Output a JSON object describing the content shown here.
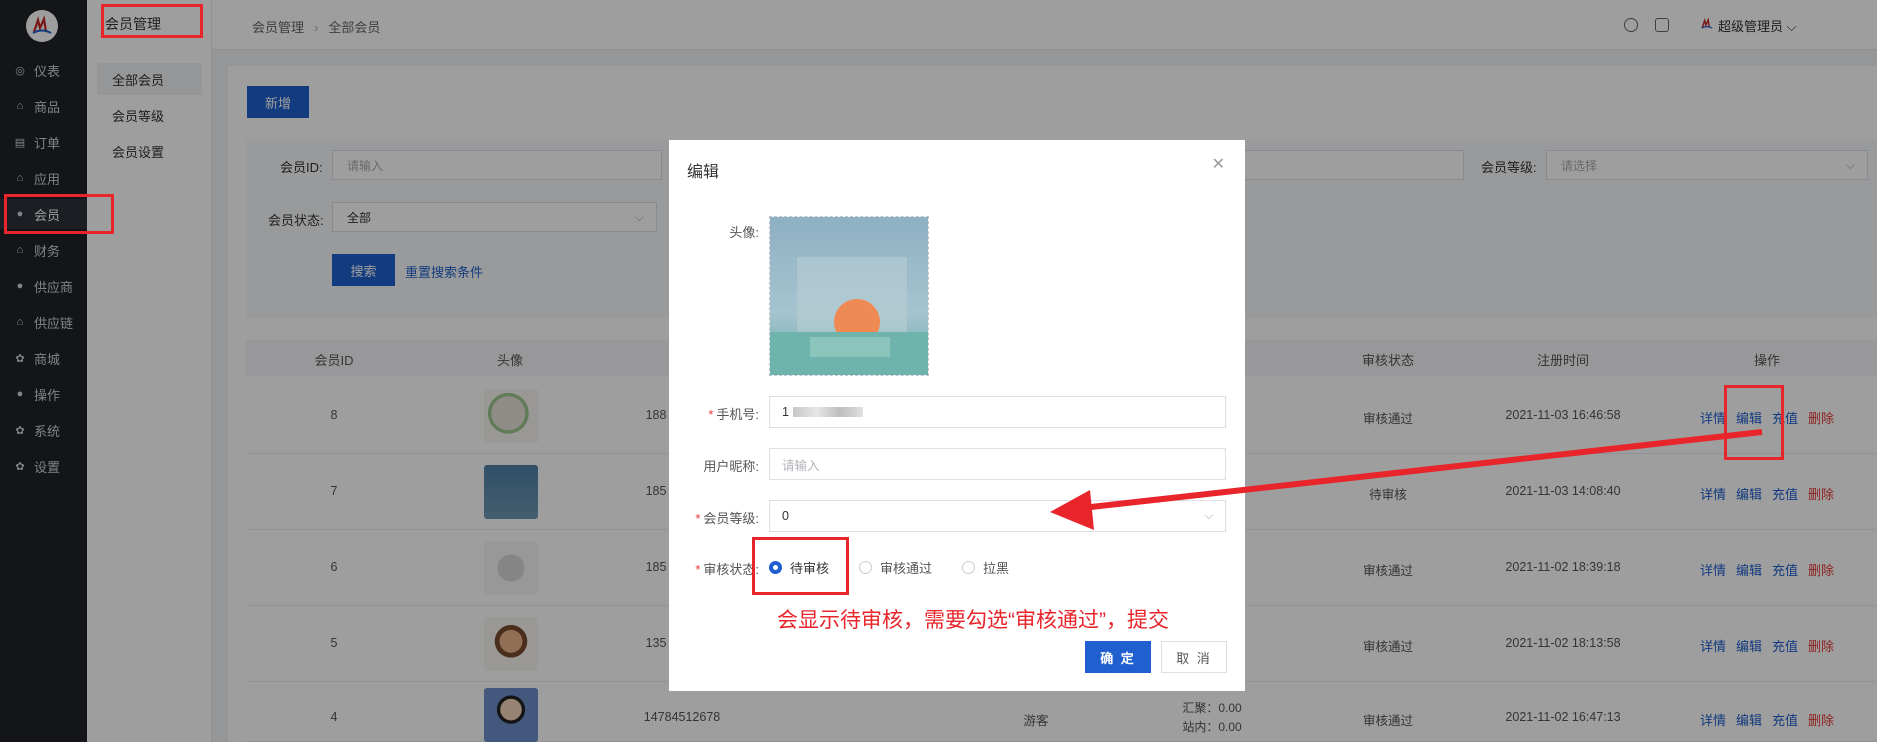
{
  "sidebar": {
    "items": [
      {
        "label": "仪表",
        "icon": "dashboard-icon"
      },
      {
        "label": "商品",
        "icon": "bag-icon"
      },
      {
        "label": "订单",
        "icon": "clipboard-icon"
      },
      {
        "label": "应用",
        "icon": "bag-icon"
      },
      {
        "label": "会员",
        "icon": "user-icon"
      },
      {
        "label": "财务",
        "icon": "bag-icon"
      },
      {
        "label": "供应商",
        "icon": "user-icon"
      },
      {
        "label": "供应链",
        "icon": "bag-icon"
      },
      {
        "label": "商城",
        "icon": "gear-icon"
      },
      {
        "label": "操作",
        "icon": "user-icon"
      },
      {
        "label": "系统",
        "icon": "gear-icon"
      },
      {
        "label": "设置",
        "icon": "gear-icon"
      }
    ]
  },
  "submenu": {
    "title": "会员管理",
    "items": [
      "全部会员",
      "会员等级",
      "会员设置"
    ]
  },
  "header": {
    "breadcrumb": [
      "会员管理",
      "全部会员"
    ],
    "admin": "超级管理员"
  },
  "toolbar": {
    "new_label": "新增"
  },
  "filter": {
    "member_id_label": "会员ID:",
    "member_id_placeholder": "请输入",
    "level_label": "会员等级:",
    "level_placeholder": "请选择",
    "status_label": "会员状态:",
    "status_value": "全部",
    "search_label": "搜索",
    "reset_label": "重置搜索条件"
  },
  "table": {
    "headers": {
      "id": "会员ID",
      "avatar": "头像",
      "audit": "审核状态",
      "reg_time": "注册时间",
      "ops": "操作"
    },
    "rows": [
      {
        "id": "8",
        "phone": "188",
        "audit": "审核通过",
        "time": "2021-11-03 16:46:58"
      },
      {
        "id": "7",
        "phone": "185",
        "audit": "待审核",
        "time": "2021-11-03 14:08:40"
      },
      {
        "id": "6",
        "phone": "185",
        "audit": "审核通过",
        "time": "2021-11-02 18:39:18"
      },
      {
        "id": "5",
        "phone": "135",
        "audit": "审核通过",
        "time": "2021-11-02 18:13:58"
      },
      {
        "id": "4",
        "phone": "14784512678",
        "level": "游客",
        "balance_a": "汇聚：0.00",
        "balance_b": "站内：0.00",
        "audit": "审核通过",
        "time": "2021-11-02 16:47:13"
      }
    ],
    "ops": [
      "详情",
      "编辑",
      "充值",
      "删除"
    ]
  },
  "modal": {
    "title": "编辑",
    "avatar_label": "头像:",
    "phone_label": "手机号:",
    "phone_value": "1",
    "nickname_label": "用户昵称:",
    "nickname_placeholder": "请输入",
    "level_label": "会员等级:",
    "level_value": "0",
    "audit_label": "审核状态:",
    "audit_options": [
      "待审核",
      "审核通过",
      "拉黑"
    ],
    "audit_selected": "待审核",
    "ok_label": "确 定",
    "cancel_label": "取 消"
  },
  "annotation": {
    "text": "会显示待审核，需要勾选“审核通过”，提交",
    "color": "#e8252a"
  }
}
